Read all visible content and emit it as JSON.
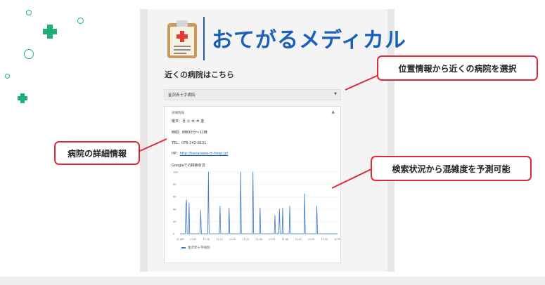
{
  "app": {
    "title": "おてがるメディカル"
  },
  "heading": "近くの病院はこちら",
  "hospital_select": {
    "selected": "金沢赤十字病院"
  },
  "details": {
    "title": "詳細情報",
    "days": "曜日：月 火 水 木 金",
    "hours": "時間：8時30分〜11時",
    "tel": "TEL：076-242-8131",
    "hp_label": "HP：",
    "hp_url": "http://kanazawa-rc-hosp.jp/",
    "chart_title": "Googleでの検索状況",
    "legend": "金沢赤十字病院"
  },
  "callouts": {
    "location": "位置情報から近くの病院を選択",
    "details": "病院の詳細情報",
    "search": "検索状況から混雑度を予測可能"
  },
  "colors": {
    "brand_blue": "#1a5fb8",
    "accent_green": "#1fae78",
    "callout_red": "#e0283a",
    "line": "#3a78c4"
  },
  "icons": {
    "logo": "clipboard-medical-icon",
    "decor_plus": "plus-icon",
    "decor_ring": "circle-icon"
  },
  "chart_data": {
    "type": "line",
    "x_ticks": [
      "11 AM",
      "11:05",
      "11:10",
      "11:15",
      "11:20",
      "11:25",
      "11:30",
      "11:35",
      "11:40",
      "11:45",
      "11:50",
      "11:55",
      "12 PM"
    ],
    "ylim": [
      0,
      100
    ],
    "y_ticks": [
      0,
      20,
      40,
      60,
      80,
      100
    ],
    "series": [
      {
        "name": "金沢赤十字病院",
        "values": [
          0,
          0,
          0,
          0,
          0,
          0,
          0,
          0,
          0,
          45,
          55,
          0,
          0,
          0,
          50,
          0,
          0,
          0,
          0,
          0,
          0,
          0,
          0,
          0,
          0,
          0,
          0,
          0,
          0,
          0,
          0,
          0,
          38,
          0,
          0,
          0,
          0,
          0,
          0,
          0,
          0,
          0,
          0,
          0,
          100,
          0,
          0,
          0,
          0,
          0,
          0,
          0,
          0,
          0,
          0,
          0,
          0,
          0,
          0,
          0,
          0,
          0,
          45,
          0,
          0,
          0,
          0,
          0,
          0,
          0,
          0,
          0,
          0,
          0,
          0,
          0,
          42,
          0,
          0,
          0,
          0,
          0,
          0,
          0,
          0,
          0,
          0,
          0,
          0,
          0,
          0,
          0,
          0,
          0,
          100,
          0,
          0,
          0,
          0,
          0,
          0,
          0,
          0,
          0,
          0,
          0,
          0,
          0,
          0,
          0,
          0,
          0,
          0,
          100,
          0,
          0,
          0,
          0,
          0,
          0,
          0,
          0,
          0,
          0,
          42,
          0,
          0,
          0,
          0,
          0,
          0,
          0,
          0,
          0,
          0,
          0,
          0,
          0,
          0,
          0,
          0,
          0,
          0,
          0,
          0,
          0,
          0,
          30,
          0,
          0,
          0,
          0,
          0,
          0,
          40,
          0,
          0,
          0,
          0,
          42,
          0,
          0,
          0,
          0,
          0,
          0,
          0,
          0,
          0,
          0,
          45,
          0,
          0,
          0,
          0,
          0,
          0,
          0,
          0,
          0,
          0,
          0,
          0,
          0,
          0,
          0,
          0,
          0,
          0,
          0,
          0,
          0,
          0,
          65,
          0,
          0,
          0,
          0,
          0,
          0,
          0,
          0,
          0,
          0,
          0,
          0,
          0,
          0,
          0,
          0,
          0,
          0,
          45,
          0,
          0,
          0,
          0,
          0,
          0,
          0,
          0,
          0,
          0,
          0,
          0,
          0,
          0,
          0,
          0,
          0,
          0,
          0,
          0,
          0,
          0,
          0,
          0,
          0,
          0,
          0,
          0,
          0,
          0,
          0,
          0
        ]
      }
    ]
  }
}
